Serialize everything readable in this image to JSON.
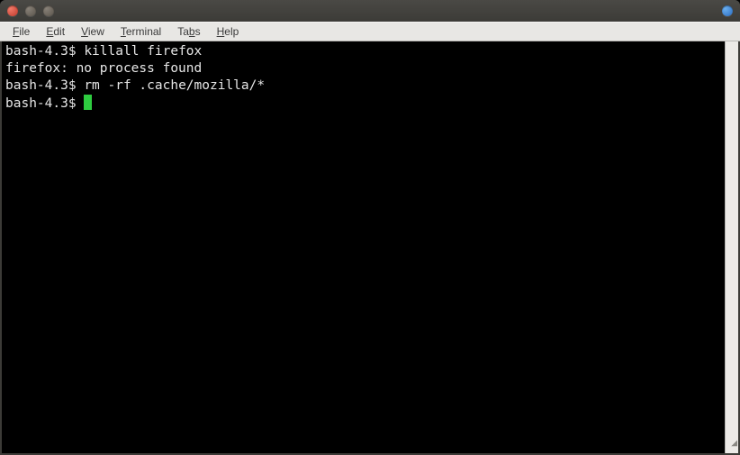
{
  "menubar": {
    "items": [
      {
        "accel": "F",
        "rest": "ile"
      },
      {
        "accel": "E",
        "rest": "dit"
      },
      {
        "accel": "V",
        "rest": "iew"
      },
      {
        "accel": "T",
        "rest": "erminal"
      },
      {
        "accel": "",
        "rest": "Ta",
        "accel2": "b",
        "rest2": "s"
      },
      {
        "accel": "H",
        "rest": "elp"
      }
    ]
  },
  "terminal": {
    "prompt": "bash-4.3$ ",
    "lines": [
      {
        "prompt": true,
        "text": "killall firefox"
      },
      {
        "prompt": false,
        "text": "firefox: no process found"
      },
      {
        "prompt": true,
        "text": "rm -rf .cache/mozilla/*"
      }
    ]
  }
}
